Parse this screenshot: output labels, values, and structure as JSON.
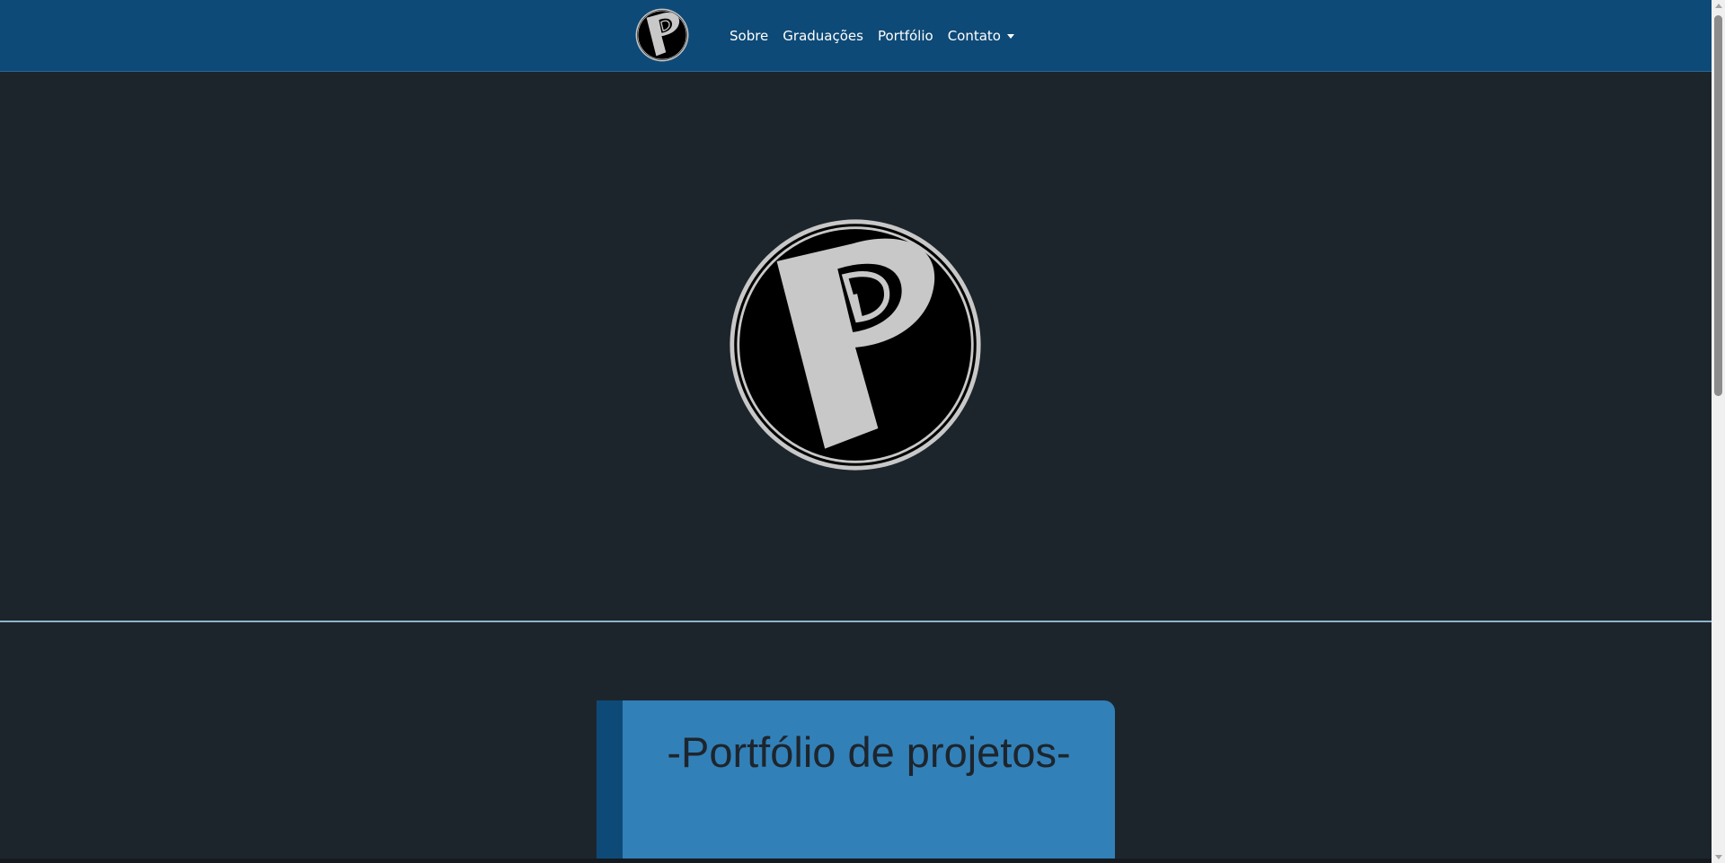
{
  "navbar": {
    "brand_icon": "p-monogram-logo-icon",
    "links": [
      {
        "label": "Sobre"
      },
      {
        "label": "Graduações"
      },
      {
        "label": "Portfólio"
      }
    ],
    "dropdown": {
      "label": "Contato",
      "icon": "caret-down-icon"
    }
  },
  "hero": {
    "logo_icon": "p-monogram-logo-icon"
  },
  "portfolio": {
    "title": "-Portfólio de projetos-"
  },
  "colors": {
    "navbar_bg": "#0e4a77",
    "page_bg": "#1d252c",
    "card_bg": "#3280b8",
    "card_stripe": "#0e4a77",
    "logo_fill": "#c8c8c8",
    "logo_bg": "#000000"
  }
}
